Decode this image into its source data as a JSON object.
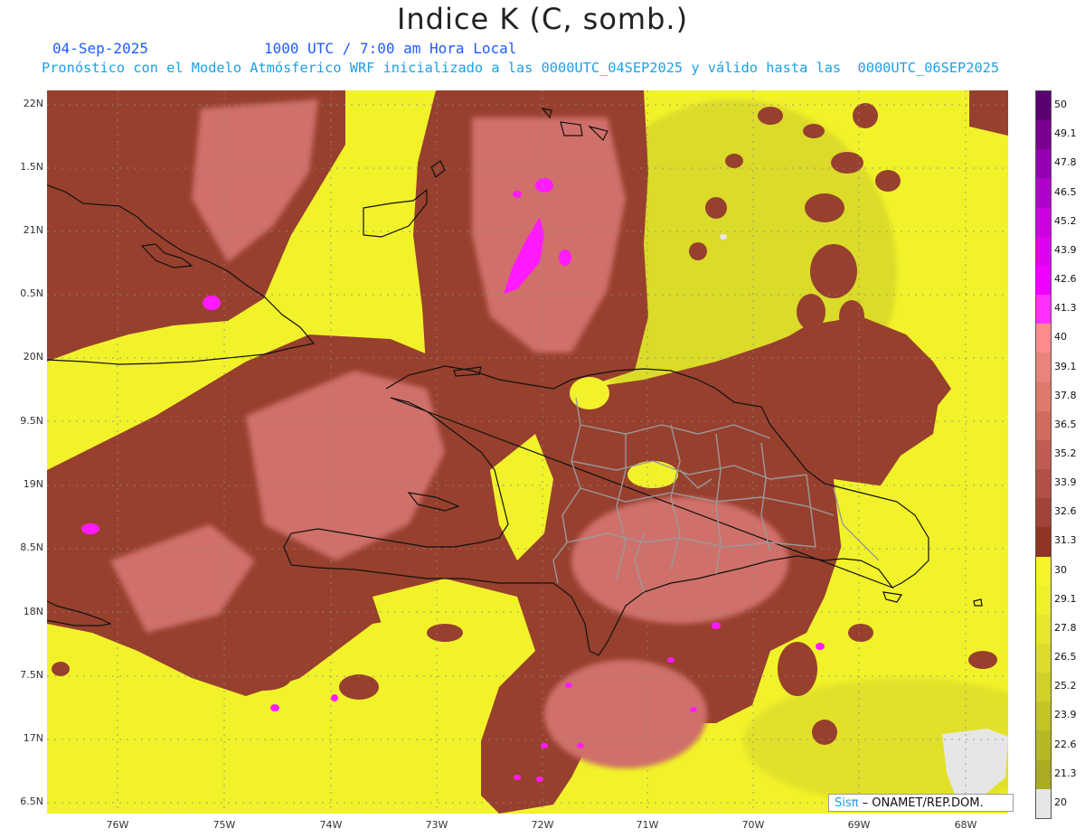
{
  "title": "Indice K (C, somb.)",
  "date": "04-Sep-2025",
  "time_label": "1000 UTC / 7:00 am Hora Local",
  "forecast_line": "Pronóstico con el Modelo Atmósferico WRF inicializado a las 0000UTC_04SEP2025 y válido hasta las  0000UTC_06SEP2025",
  "lat_labels": [
    "22N",
    "1.5N",
    "21N",
    "0.5N",
    "20N",
    "9.5N",
    "19N",
    "8.5N",
    "18N",
    "7.5N",
    "17N",
    "6.5N"
  ],
  "lon_labels": [
    "76W",
    "75W",
    "74W",
    "73W",
    "72W",
    "71W",
    "70W",
    "69W",
    "68W"
  ],
  "colorbar": {
    "labels": [
      "50",
      "49.1",
      "47.8",
      "46.5",
      "45.2",
      "43.9",
      "42.6",
      "41.3",
      "40",
      "39.1",
      "37.8",
      "36.5",
      "35.2",
      "33.9",
      "32.6",
      "31.3",
      "30",
      "29.1",
      "27.8",
      "26.5",
      "25.2",
      "23.9",
      "22.6",
      "21.3",
      "20"
    ],
    "colors": [
      "#5a0070",
      "#7a0090",
      "#9400b0",
      "#b000cc",
      "#cc00e0",
      "#e000f0",
      "#f000ff",
      "#ff30ff",
      "#ff8c8c",
      "#e8857a",
      "#dc7a6e",
      "#ce6c60",
      "#bf5d52",
      "#b05046",
      "#a0443a",
      "#8f3526",
      "#f5f52a",
      "#eef02a",
      "#e6e62a",
      "#dcdc28",
      "#cfd126",
      "#c2c424",
      "#b5b822",
      "#a9ac20",
      "#e6e6e6"
    ]
  },
  "credit": {
    "brand": "Sisπ",
    "org": " – ONAMET/REP.DOM."
  }
}
